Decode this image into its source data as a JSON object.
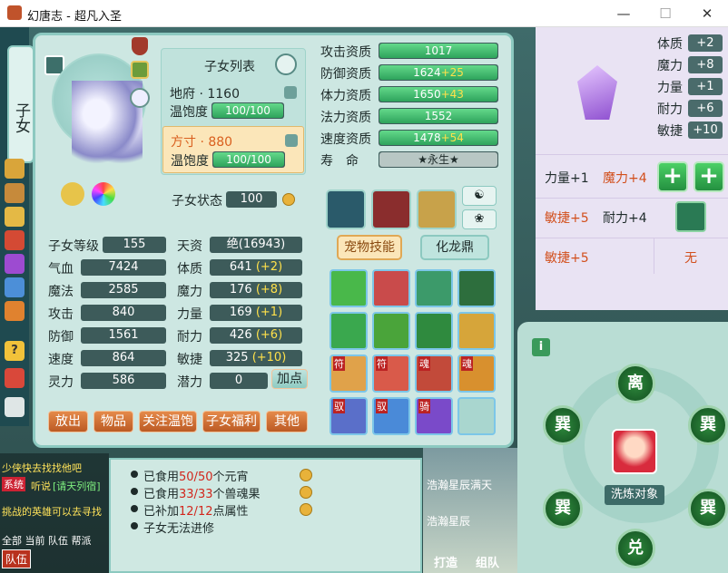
{
  "window": {
    "title": "幻唐志 - 超凡入圣",
    "min": "—",
    "max": "☐",
    "close": "✕"
  },
  "tab": {
    "label": "子女"
  },
  "list": {
    "title": "子女列表",
    "child1": {
      "name": "地府 · 1160",
      "sat_label": "温饱度",
      "sat_value": "100/100"
    },
    "child2": {
      "name": "方寸 · 880",
      "sat_label": "温饱度",
      "sat_value": "100/100"
    }
  },
  "status": {
    "label": "子女状态",
    "value": "100"
  },
  "stats": [
    {
      "l1": "子女等级",
      "v1": "155",
      "l2": "天资",
      "v2": "绝(16943)",
      "p2": ""
    },
    {
      "l1": "气血",
      "v1": "7424",
      "l2": "体质",
      "v2": "641",
      "p2": "(+2)"
    },
    {
      "l1": "魔法",
      "v1": "2585",
      "l2": "魔力",
      "v2": "176",
      "p2": "(+8)"
    },
    {
      "l1": "攻击",
      "v1": "840",
      "l2": "力量",
      "v2": "169",
      "p2": "(+1)"
    },
    {
      "l1": "防御",
      "v1": "1561",
      "l2": "耐力",
      "v2": "426",
      "p2": "(+6)"
    },
    {
      "l1": "速度",
      "v1": "864",
      "l2": "敏捷",
      "v2": "325",
      "p2": "(+10)"
    },
    {
      "l1": "灵力",
      "v1": "586",
      "l2": "潜力",
      "v2": "0",
      "p2": ""
    }
  ],
  "addpoint": "加点",
  "buttons": [
    "放出",
    "物品",
    "关注温饱",
    "子女福利",
    "其他"
  ],
  "apt": [
    {
      "l": "攻击资质",
      "v": "1017",
      "p": ""
    },
    {
      "l": "防御资质",
      "v": "1624",
      "p": "+25"
    },
    {
      "l": "体力资质",
      "v": "1650",
      "p": "+43"
    },
    {
      "l": "法力资质",
      "v": "1552",
      "p": ""
    },
    {
      "l": "速度资质",
      "v": "1478",
      "p": "+54"
    },
    {
      "l": "寿　命",
      "v": "★永生★",
      "p": ""
    }
  ],
  "tabs2": {
    "skill": "宠物技能",
    "hualong": "化龙鼎"
  },
  "skill_marks": [
    "符",
    "符",
    "魂",
    "魂",
    "驭",
    "驭",
    "骑"
  ],
  "right": {
    "attrs": [
      {
        "l": "体质",
        "v": "+2"
      },
      {
        "l": "魔力",
        "v": "+8"
      },
      {
        "l": "力量",
        "v": "+1"
      },
      {
        "l": "耐力",
        "v": "+6"
      },
      {
        "l": "敏捷",
        "v": "+10"
      }
    ],
    "row1": {
      "a": "力量+1",
      "b": "魔力+4"
    },
    "row2": {
      "a": "敏捷+5",
      "b": "耐力+4"
    },
    "row3": {
      "a": "敏捷+5",
      "b": "无"
    },
    "plus": "+"
  },
  "wash": {
    "target": "洗炼对象",
    "gems": [
      "离",
      "巽",
      "巽",
      "巽",
      "巽",
      "兑"
    ]
  },
  "info": [
    "已食用50/50个元宵",
    "已食用33/33个兽魂果",
    "已补加12/12点属性",
    "子女无法进修"
  ],
  "chat": {
    "l1": "少侠快去找找他吧",
    "sys": "系统",
    "l2a": "听说",
    "l2b": "[请天列宿]",
    "l3": "挑战的英雄可以去寻找",
    "tabs": "全部 当前 队伍 帮派",
    "team": "队伍"
  },
  "scene": {
    "s1": "浩瀚星辰满天",
    "s2": "浩瀚星辰",
    "a": "打造",
    "b": "组队"
  }
}
